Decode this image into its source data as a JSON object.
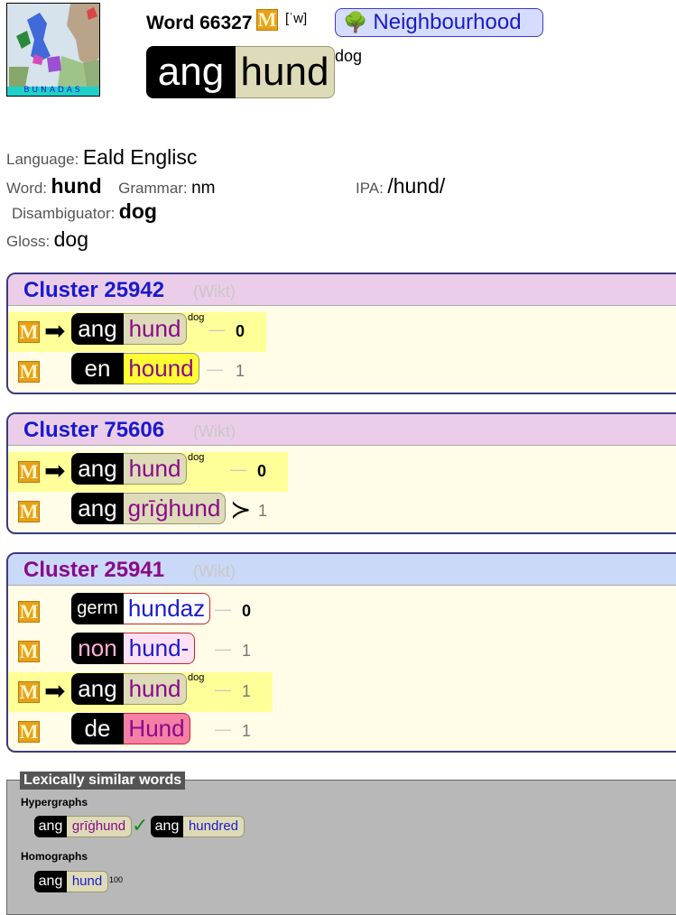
{
  "header": {
    "logo_text": "BUNADAS",
    "word_title": "Word 66327",
    "m_icon": "M",
    "ipa_small": "[ˈw]",
    "neighbourhood_label": "Neighbourhood",
    "neighbourhood_icon": "tree-icon",
    "lang": "ang",
    "word": "hund",
    "gloss": "dog"
  },
  "info": {
    "language_label": "Language:",
    "language_value": "Eald Englisc",
    "word_label": "Word:",
    "word_value": "hund",
    "grammar_label": "Grammar:",
    "grammar_value": "nm",
    "ipa_label": "IPA:",
    "ipa_value": "/hund/",
    "disambiguator_label": "Disambiguator:",
    "disambiguator_value": "dog",
    "gloss_label": "Gloss:",
    "gloss_value": "dog"
  },
  "clusters": [
    {
      "title": "Cluster 25942",
      "wikt": "(Wikt)",
      "rows": [
        {
          "lang": "ang",
          "word": "hund",
          "gloss": "dog",
          "dash": "—",
          "num": "0",
          "current": true
        },
        {
          "lang": "en",
          "word": "hound",
          "gloss": "",
          "dash": "—",
          "num": "1",
          "current": false
        }
      ]
    },
    {
      "title": "Cluster 75606",
      "wikt": "(Wikt)",
      "rows": [
        {
          "lang": "ang",
          "word": "hund",
          "gloss": "dog",
          "dash": "—",
          "num": "0",
          "current": true
        },
        {
          "lang": "ang",
          "word": "grīġhund",
          "gloss": "",
          "dash": "≻",
          "num": "1",
          "current": false
        }
      ]
    },
    {
      "title": "Cluster 25941",
      "wikt": "(Wikt)",
      "rows": [
        {
          "lang": "germ",
          "word": "hundaz",
          "gloss": "",
          "dash": "—",
          "num": "0",
          "current": false
        },
        {
          "lang": "non",
          "word": "hund-",
          "gloss": "",
          "dash": "—",
          "num": "1",
          "current": false
        },
        {
          "lang": "ang",
          "word": "hund",
          "gloss": "dog",
          "dash": "—",
          "num": "1",
          "current": true
        },
        {
          "lang": "de",
          "word": "Hund",
          "gloss": "",
          "dash": "—",
          "num": "1",
          "current": false
        }
      ]
    }
  ],
  "lexically_similar": {
    "title": "Lexically similar words",
    "hypergraphs_label": "Hypergraphs",
    "hypergraphs": [
      {
        "lang": "ang",
        "word": "grīġhund",
        "mark": "✓"
      },
      {
        "lang": "ang",
        "word": "hundred",
        "mark": ""
      }
    ],
    "homographs_label": "Homographs",
    "homographs": [
      {
        "lang": "ang",
        "word": "hund",
        "sup": "100"
      }
    ]
  },
  "colors": {
    "ang_word_bg": "#dedbb8",
    "en_word_bg": "#ffff33",
    "germ_word_bg": "#ffffff",
    "non_word_bg": "#fde0f4",
    "de_word_bg": "#f57fa5",
    "cluster_header_pink": "#ebcdea",
    "cluster_header_blue": "#cad9f7",
    "highlight": "#ffff99",
    "m_icon": "#e5a21a"
  }
}
